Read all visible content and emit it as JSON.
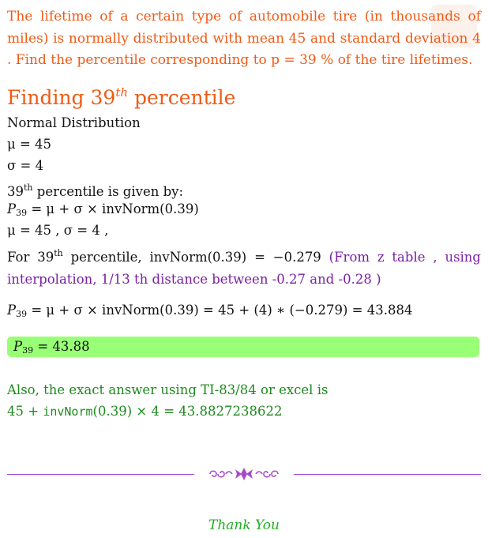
{
  "problem": {
    "text": "The lifetime of a certain type of automobile tire (in thousands of miles) is normally distributed with mean 45 and standard deviation 4 . Find the percentile corresponding to p = 39 % of the tire lifetimes."
  },
  "heading": {
    "prefix": "Finding 39",
    "sup": "th",
    "suffix": " percentile"
  },
  "solution": {
    "dist_label": "Normal Distribution",
    "mu_line": "μ = 45",
    "sigma_line": "σ = 4",
    "given_num": "39",
    "given_sup": "th",
    "given_rest": " percentile is given by:",
    "formula_P": "P",
    "formula_sub": "39",
    "formula_rest": " = μ + σ × invNorm(0.39)",
    "params_line": "μ = 45 , σ = 4 ,",
    "for_text": "For 39",
    "for_sup": "th",
    "for_rest": " percentile,  invNorm(0.39)  =  −0.279  ",
    "note": "(From z table , using interpolation, 1/13 th distance between -0.27 and -0.28 )",
    "calc_P": "P",
    "calc_sub": "39",
    "calc_rest": " = μ + σ × invNorm(0.39) = 45 + (4) ∗ (−0.279) = 43.884"
  },
  "answer": {
    "P": "P",
    "sub": "39",
    "rest": " = 43.88"
  },
  "also": {
    "line1": "Also, the exact answer using TI-83/84 or excel is",
    "pre": "45 + ",
    "code": "invNorm",
    "post": "(0.39) × 4 = 43.8827238622"
  },
  "footer": {
    "thanks": "Thank You"
  },
  "colors": {
    "orange": "#f05a14",
    "purple": "#7a1fa2",
    "answer_bg": "#99ff77",
    "green": "#1d8a1d"
  }
}
